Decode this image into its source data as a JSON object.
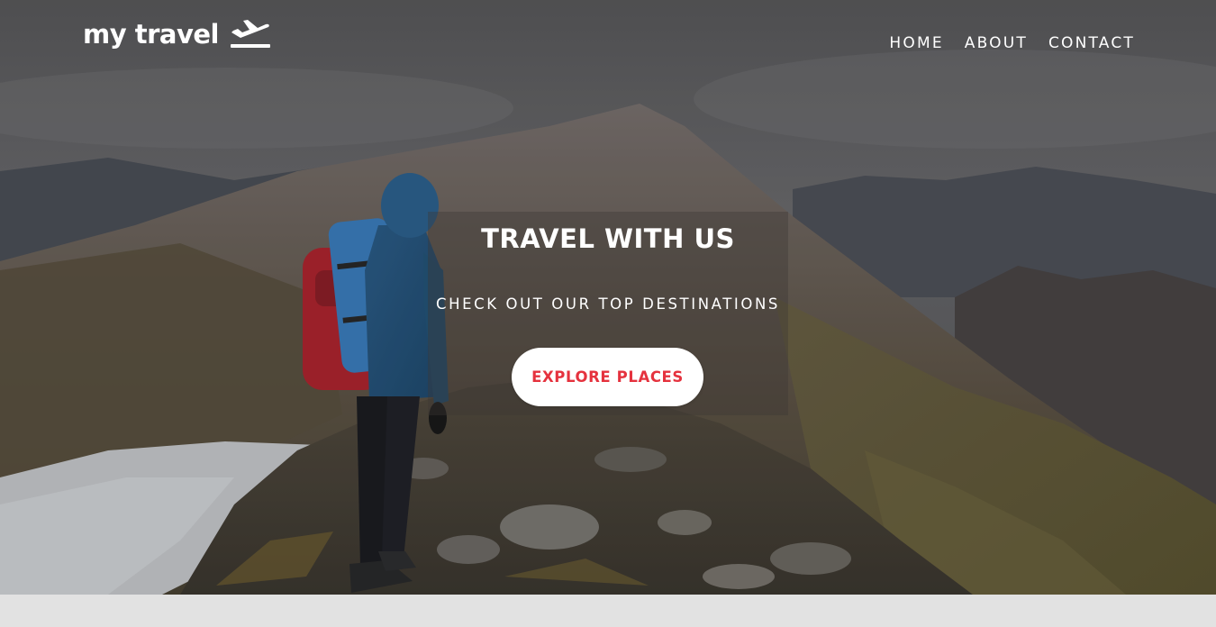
{
  "header": {
    "logo_text": "my travel",
    "logo_icon": "airplane-departure-icon"
  },
  "nav": {
    "items": [
      {
        "label": "HOME"
      },
      {
        "label": "ABOUT"
      },
      {
        "label": "CONTACT"
      }
    ]
  },
  "hero": {
    "title": "TRAVEL WITH US",
    "subtitle": "CHECK OUT OUR TOP DESTINATIONS",
    "cta_label": "EXPLORE PLACES",
    "background": "hiker-on-mountain-ridge-photo"
  },
  "colors": {
    "accent": "#e5323e",
    "text_on_hero": "#ffffff",
    "footer_strip": "#e2e2e2"
  }
}
